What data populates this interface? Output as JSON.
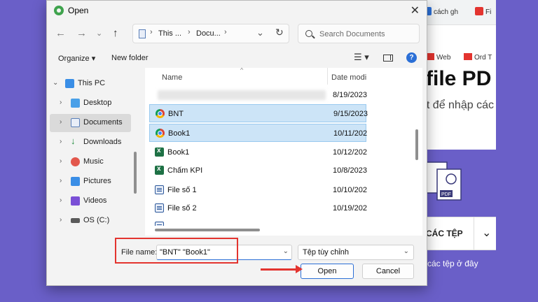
{
  "colors": {
    "backdrop": "#6a5fc8",
    "selection": "#cce4f7",
    "accent": "#2b6fd6",
    "annotation": "#e3342f"
  },
  "background_page": {
    "tabs": [
      {
        "label": "cách gh",
        "icon": "search-result-icon"
      },
      {
        "label": "Fi",
        "icon": "bookmark-icon"
      }
    ],
    "bookmarks": [
      {
        "label": "Web",
        "icon": "web-icon"
      },
      {
        "label": "Ord T",
        "icon": "bookmark-icon"
      }
    ],
    "heading": "file PD",
    "subheading": "ất để nhập các",
    "section_bar": {
      "label": "CÁC TỆP",
      "chevron": "chevron-down-icon"
    },
    "drop_text": "a các tệp ở đây"
  },
  "dialog": {
    "title": "Open",
    "title_icon": "app-logo-icon",
    "close_icon": "close-icon",
    "nav": {
      "back_icon": "arrow-left-icon",
      "forward_icon": "arrow-right-icon",
      "recent_icon": "chevron-down-icon",
      "up_icon": "arrow-up-icon"
    },
    "address": {
      "segments": [
        "This ...",
        "Docu..."
      ],
      "refresh_icon": "refresh-icon"
    },
    "search": {
      "placeholder": "Search Documents"
    },
    "commands": {
      "organize": "Organize ▾",
      "new_folder": "New folder",
      "view_icon": "view-options-icon",
      "preview_pane_icon": "preview-pane-icon",
      "help_icon": "help-icon",
      "help_symbol": "?"
    },
    "navigation_pane": [
      {
        "label": "This PC",
        "icon": "computer-icon",
        "expanded": true
      },
      {
        "label": "Desktop",
        "icon": "desktop-icon"
      },
      {
        "label": "Documents",
        "icon": "documents-icon",
        "selected": true
      },
      {
        "label": "Downloads",
        "icon": "download-icon"
      },
      {
        "label": "Music",
        "icon": "music-icon"
      },
      {
        "label": "Pictures",
        "icon": "pictures-icon"
      },
      {
        "label": "Videos",
        "icon": "videos-icon"
      },
      {
        "label": "OS (C:)",
        "icon": "drive-icon"
      }
    ],
    "file_list": {
      "columns": {
        "name": "Name",
        "date": "Date modi"
      },
      "rows": [
        {
          "name": "",
          "date": "8/19/2023",
          "icon": "blurred",
          "selected": false
        },
        {
          "name": "BNT",
          "date": "9/15/2023",
          "icon": "chrome-icon",
          "selected": true
        },
        {
          "name": "Book1",
          "date": "10/11/202",
          "icon": "chrome-icon",
          "selected": true
        },
        {
          "name": "Book1",
          "date": "10/12/202",
          "icon": "excel-icon",
          "selected": false
        },
        {
          "name": "Chấm KPI",
          "date": "10/8/2023",
          "icon": "excel-icon",
          "selected": false
        },
        {
          "name": "File số 1",
          "date": "10/10/202",
          "icon": "word-icon",
          "selected": false
        },
        {
          "name": "File số 2",
          "date": "10/19/202",
          "icon": "word-icon",
          "selected": false
        }
      ]
    },
    "footer": {
      "file_name_label": "File name:",
      "file_name_value": "\"BNT\" \"Book1\"",
      "file_type": "Tệp tùy chỉnh",
      "open_label": "Open",
      "cancel_label": "Cancel"
    }
  }
}
